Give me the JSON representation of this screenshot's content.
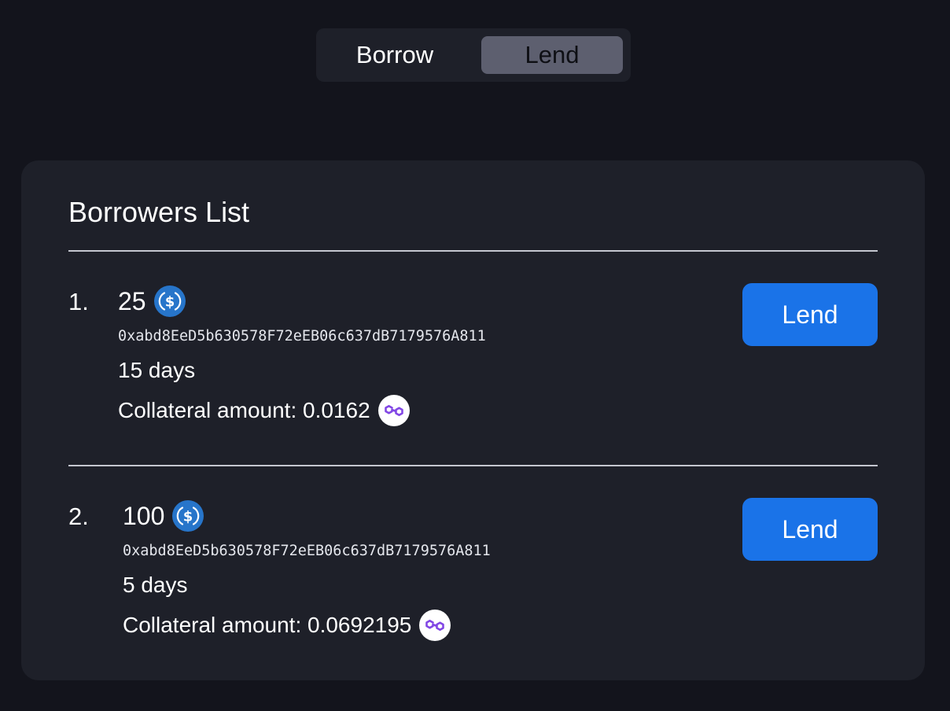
{
  "toggle": {
    "borrow_label": "Borrow",
    "lend_label": "Lend",
    "selected": "Lend"
  },
  "card": {
    "title": "Borrowers List"
  },
  "borrowers": [
    {
      "index": "1.",
      "amount": "25",
      "amount_icon": "usdc-icon",
      "address": "0xabd8EeD5b630578F72eEB06c637dB7179576A811",
      "duration": "15 days",
      "collateral": "Collateral amount: 0.0162",
      "collateral_icon": "matic-icon",
      "button_label": "Lend"
    },
    {
      "index": "2.",
      "amount": "100",
      "amount_icon": "usdc-icon",
      "address": "0xabd8EeD5b630578F72eEB06c637dB7179576A811",
      "duration": "5 days",
      "collateral": "Collateral amount: 0.0692195",
      "collateral_icon": "matic-icon",
      "button_label": "Lend"
    }
  ],
  "colors": {
    "background": "#13141c",
    "card": "#1e2029",
    "accent": "#1a73e8",
    "toggle_selected": "#5d5f6f",
    "usdc": "#2775ca",
    "matic": "#8247e5"
  }
}
